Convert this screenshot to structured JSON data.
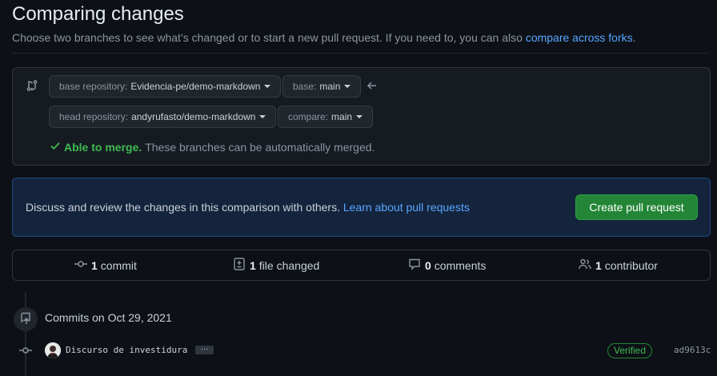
{
  "header": {
    "title": "Comparing changes",
    "subtitle": "Choose two branches to see what’s changed or to start a new pull request. If you need to, you can also ",
    "subtitle_link": "compare across forks",
    "subtitle_end": "."
  },
  "range": {
    "base_repo_label": "base repository:",
    "base_repo_value": "Evidencia-pe/demo-markdown",
    "base_label": "base:",
    "base_value": "main",
    "head_repo_label": "head repository:",
    "head_repo_value": "andyrufasto/demo-markdown",
    "compare_label": "compare:",
    "compare_value": "main",
    "merge_status": "Able to merge.",
    "merge_detail": "These branches can be automatically merged."
  },
  "discuss": {
    "text": "Discuss and review the changes in this comparison with others. ",
    "link": "Learn about pull requests",
    "button": "Create pull request"
  },
  "stats": {
    "commits_count": "1",
    "commits_label": "commit",
    "files_count": "1",
    "files_label": "file changed",
    "comments_count": "0",
    "comments_label": "comments",
    "contributors_count": "1",
    "contributors_label": "contributor"
  },
  "commits": {
    "group_heading": "Commits on Oct 29, 2021",
    "items": [
      {
        "message": "Discurso de investidura",
        "ellipsis": "…",
        "badge": "Verified",
        "sha": "ad9613c"
      }
    ]
  },
  "colors": {
    "background": "#0d1117",
    "accent_link": "#58a6ff",
    "success": "#3fb950",
    "button_green": "#238636"
  }
}
